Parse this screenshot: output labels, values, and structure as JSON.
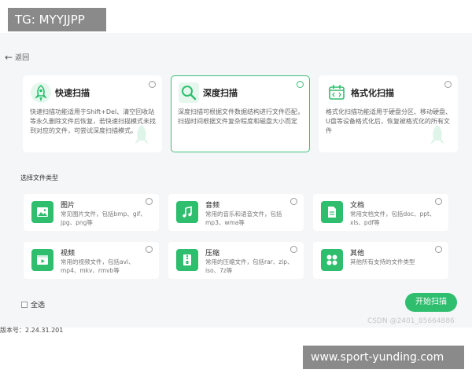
{
  "top_badge": "TG: MYYJJPP",
  "nav": {
    "back_label": "返回"
  },
  "scan_modes": [
    {
      "title": "快速扫描",
      "desc": "快速扫描功能适用于Shift+Del、清空回收站等永久删除文件后恢复，若快速扫描模式未找到对应的文件，可尝试深度扫描模式。",
      "icon": "rocket-icon",
      "selected": false
    },
    {
      "title": "深度扫描",
      "desc": "深度扫描可根据文件数据结构进行文件匹配，扫描时间根据文件复杂程度和磁盘大小而定",
      "icon": "magnifier-icon",
      "selected": true
    },
    {
      "title": "格式化扫描",
      "desc": "格式化扫描功能适用于硬盘分区、移动硬盘、U盘等设备格式化后，恢复被格式化的所有文件",
      "icon": "format-disk-icon",
      "selected": false
    }
  ],
  "file_types": {
    "section_title": "选择文件类型",
    "items": [
      {
        "title": "图片",
        "desc": "常见图片文件，包括bmp、gif、jpg、png等",
        "icon": "image-icon"
      },
      {
        "title": "音频",
        "desc": "常用的音乐和语音文件，包括mp3、wma等",
        "icon": "music-icon"
      },
      {
        "title": "文档",
        "desc": "常用文档文件，包括doc、ppt、xls、pdf等",
        "icon": "document-icon"
      },
      {
        "title": "视频",
        "desc": "常用的视频文件，包括avi、mp4、mkv、rmvb等",
        "icon": "video-icon"
      },
      {
        "title": "压缩",
        "desc": "常用的压缩文件，包括rar、zip、iso、7z等",
        "icon": "archive-icon"
      },
      {
        "title": "其他",
        "desc": "其他所有支持的文件类型",
        "icon": "grid-icon"
      }
    ]
  },
  "footer": {
    "select_all_label": "全选",
    "start_button_label": "开始扫描",
    "version_text": "版本号：2.24.31.201"
  },
  "watermark": "CSDN @2401_85664886",
  "url_badge": "www.sport-yunding.com",
  "colors": {
    "accent": "#2fbd6e",
    "selected_border": "#3dbf7a",
    "background": "#f5f6f8"
  }
}
